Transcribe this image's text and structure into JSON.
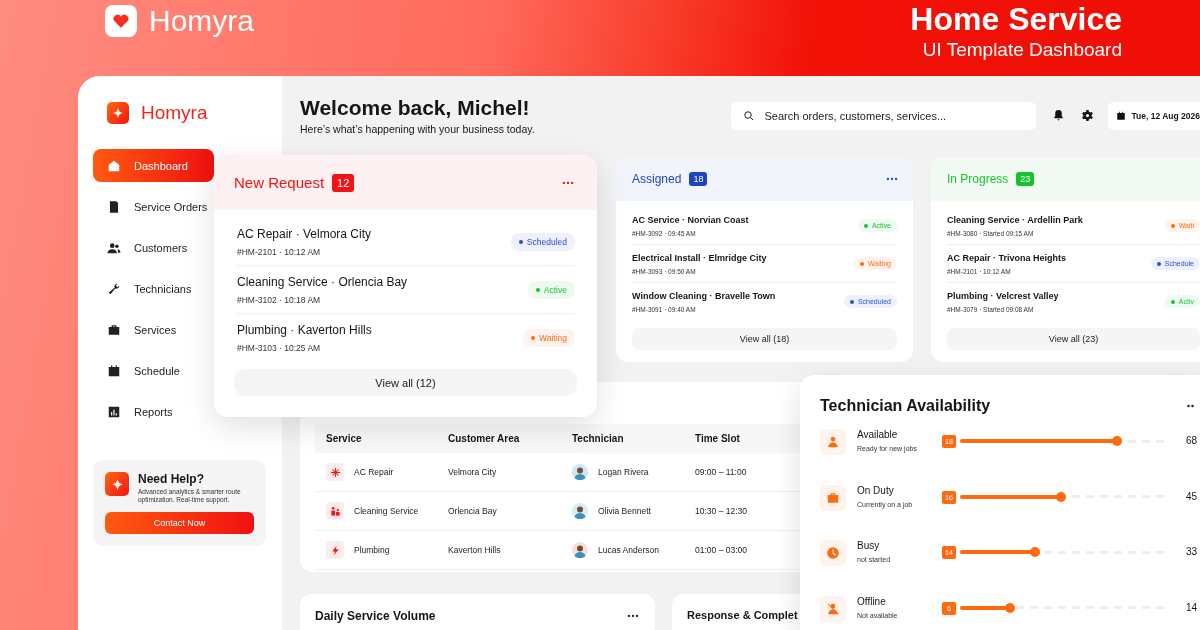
{
  "banner": {
    "brand": "Homyra",
    "title": "Home Service",
    "subtitle": "UI Template Dashboard"
  },
  "sidebar": {
    "brand": "Homyra",
    "items": [
      {
        "label": "Dashboard",
        "selected": true
      },
      {
        "label": "Service Orders",
        "selected": false
      },
      {
        "label": "Customers",
        "selected": false
      },
      {
        "label": "Technicians",
        "selected": false
      },
      {
        "label": "Services",
        "selected": false
      },
      {
        "label": "Schedule",
        "selected": false
      },
      {
        "label": "Reports",
        "selected": false
      }
    ],
    "help": {
      "title": "Need Help?",
      "text": "Advanced analytics & smarter route optimization. Real-time support.",
      "button": "Contact Now"
    }
  },
  "header": {
    "title": "Welcome back, Michel!",
    "subtitle": "Here’s what’s happening with your business today.",
    "search": {
      "placeholder": "Search orders, customers, services..."
    },
    "date": "Tue, 12 Aug 2026"
  },
  "columns": [
    {
      "title": "New Request",
      "count": "12",
      "color": "#f01414",
      "button": "View all (12)",
      "items": [
        {
          "title": "AC Repair · Velmora City",
          "meta": "#HM-2101 · 10:12 AM",
          "status": "Scheduled",
          "color": "#2a4fd0"
        },
        {
          "title": "Cleaning Service · Orlencia Bay",
          "meta": "#HM-3102 · 10:18 AM",
          "status": "Active",
          "color": "#1fbf3a"
        },
        {
          "title": "Plumbing · Kaverton Hills",
          "meta": "#HM-3103 · 10:25 AM",
          "status": "Waiting",
          "color": "#ff6a1a"
        }
      ]
    },
    {
      "title": "Assigned",
      "count": "18",
      "color": "#1f44c0",
      "button": "View all (18)",
      "items": [
        {
          "title": "AC Service · Norvian Coast",
          "meta": "#HM-3092 · 09:45 AM",
          "status": "Active",
          "color": "#1fbf3a"
        },
        {
          "title": "Electrical Install · Elmridge City",
          "meta": "#HM-3093 · 09:50 AM",
          "status": "Waiting",
          "color": "#ff6a1a"
        },
        {
          "title": "Window Cleaning · Bravelle Town",
          "meta": "#HM-3091 · 09:40 AM",
          "status": "Scheduled",
          "color": "#2a4fd0"
        }
      ]
    },
    {
      "title": "In Progress",
      "count": "23",
      "color": "#17c22e",
      "button": "View all (23)",
      "items": [
        {
          "title": "Cleaning Service · Ardellin Park",
          "meta": "#HM-3080 · Started 09:15 AM",
          "status": "Waiti",
          "color": "#ff6a1a"
        },
        {
          "title": "AC Repair · Trivona Heights",
          "meta": "#HM-2101 · 10:12 AM",
          "status": "Schedule",
          "color": "#2a4fd0"
        },
        {
          "title": "Plumbing · Velcrest Valley",
          "meta": "#HM-3079 · Started 09:08 AM",
          "status": "Activ",
          "color": "#1fbf3a"
        }
      ]
    }
  ],
  "table": {
    "columns": [
      "Service",
      "Customer Area",
      "Technician",
      "Time Slot"
    ],
    "rows": [
      {
        "service": "AC Repair",
        "area": "Velmora City",
        "technician": "Logan Rivera",
        "time": "09:00 – 11:00"
      },
      {
        "service": "Cleaning Service",
        "area": "Orlencia Bay",
        "technician": "Olivia Bennett",
        "time": "10:30 – 12:30"
      },
      {
        "service": "Plumbing",
        "area": "Kaverton Hills",
        "technician": "Lucas Anderson",
        "time": "01:00 – 03:00"
      }
    ]
  },
  "bottom_cards": [
    {
      "title": "Daily Service Volume"
    },
    {
      "title": "Response & Complet"
    }
  ],
  "availability": {
    "title": "Technician Availability",
    "rows": [
      {
        "label": "Available",
        "sub": "Ready for new jobs",
        "count": "18",
        "level": 0.76,
        "percent": "68"
      },
      {
        "label": "On Duty",
        "sub": "Currently on a job",
        "count": "16",
        "level": 0.49,
        "percent": "45"
      },
      {
        "label": "Busy",
        "sub": "not started",
        "count": "14",
        "level": 0.36,
        "percent": "33"
      },
      {
        "label": "Offline",
        "sub": "Not available",
        "count": "6",
        "level": 0.24,
        "percent": "14"
      }
    ]
  }
}
